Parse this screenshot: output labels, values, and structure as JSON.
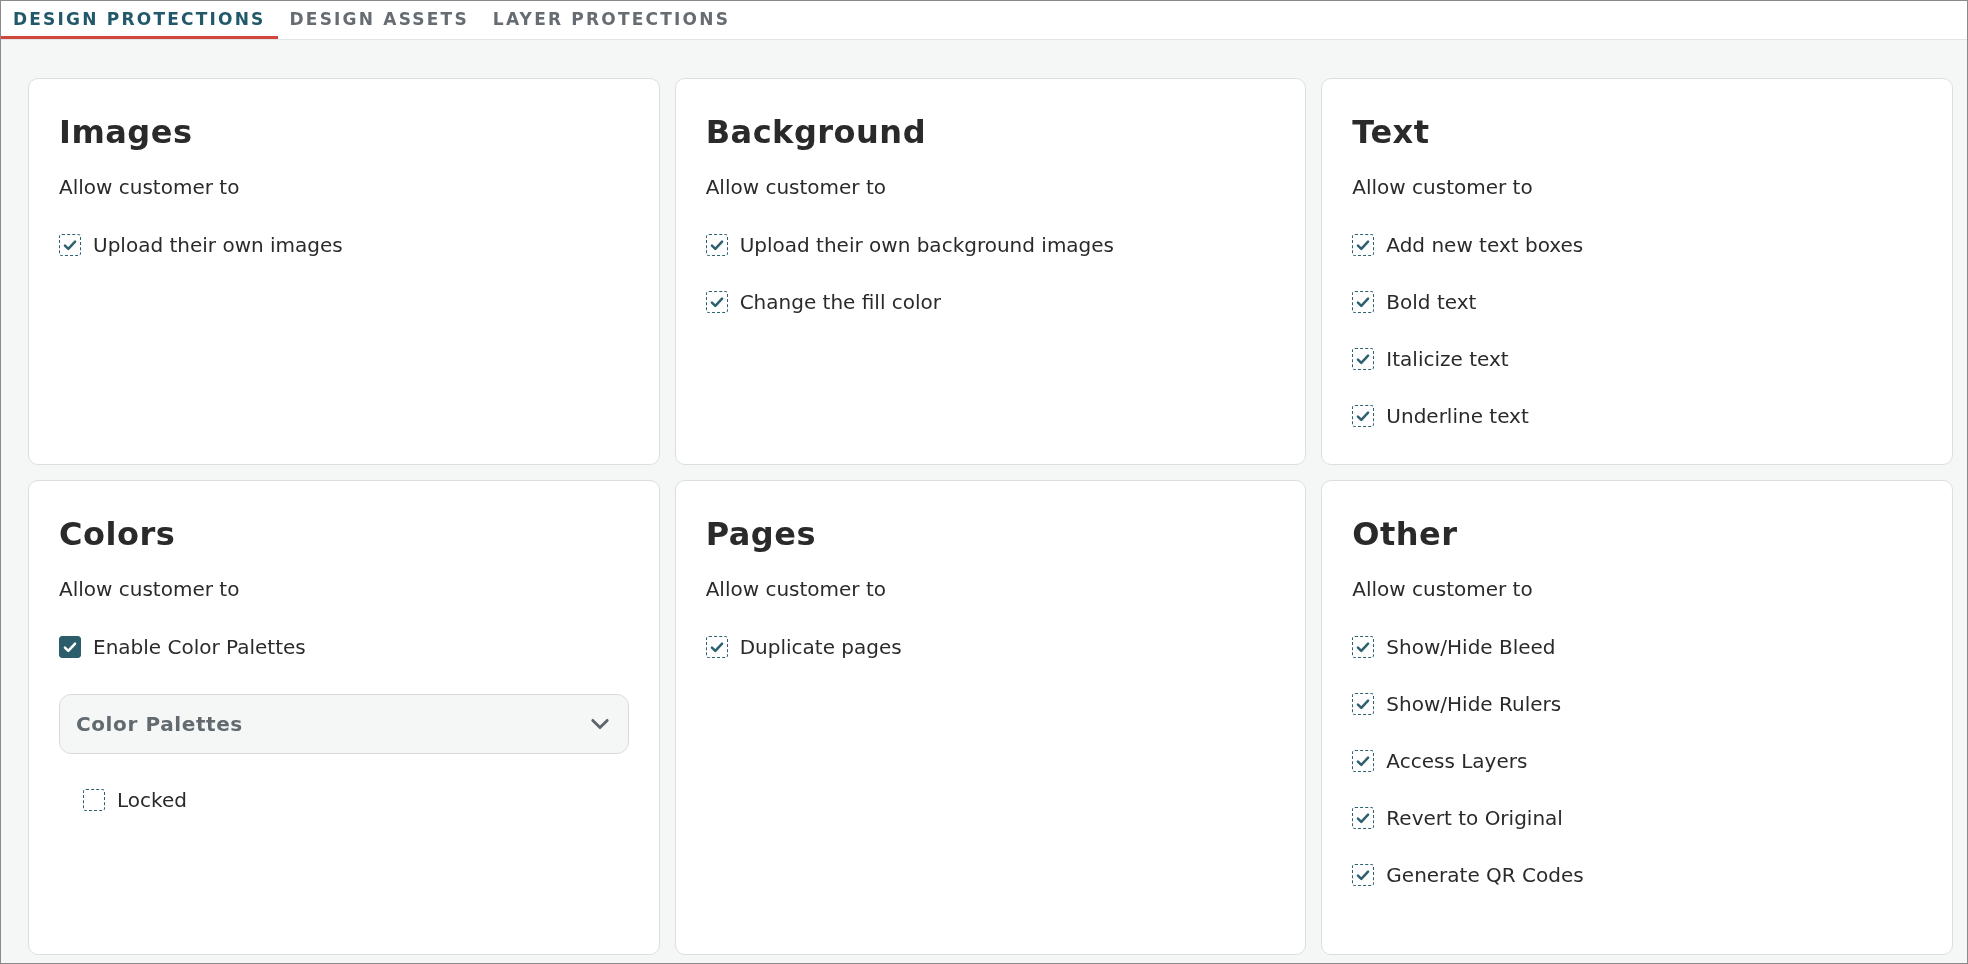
{
  "tabs": [
    {
      "label": "DESIGN PROTECTIONS",
      "selected": true
    },
    {
      "label": "DESIGN ASSETS",
      "selected": false
    },
    {
      "label": "LAYER PROTECTIONS",
      "selected": false
    }
  ],
  "cards": [
    {
      "title": "Images",
      "subtitle": "Allow customer to",
      "items": [
        {
          "kind": "checkbox",
          "label": "Upload their own images",
          "checked": true
        }
      ]
    },
    {
      "title": "Background",
      "subtitle": "Allow customer to",
      "items": [
        {
          "kind": "checkbox",
          "label": "Upload their own background images",
          "checked": true
        },
        {
          "kind": "checkbox",
          "label": "Change the fill color",
          "checked": true
        }
      ]
    },
    {
      "title": "Text",
      "subtitle": "Allow customer to",
      "items": [
        {
          "kind": "checkbox",
          "label": "Add new text boxes",
          "checked": true
        },
        {
          "kind": "checkbox",
          "label": "Bold text",
          "checked": true
        },
        {
          "kind": "checkbox",
          "label": "Italicize text",
          "checked": true
        },
        {
          "kind": "checkbox",
          "label": "Underline text",
          "checked": true
        }
      ]
    },
    {
      "title": "Colors",
      "subtitle": "Allow customer to",
      "items": [
        {
          "kind": "solid-checkbox",
          "label": "Enable Color Palettes",
          "checked": true
        },
        {
          "kind": "dropdown",
          "label": "Color Palettes",
          "children": [
            {
              "kind": "checkbox",
              "label": "Locked",
              "checked": false
            }
          ]
        }
      ]
    },
    {
      "title": "Pages",
      "subtitle": "Allow customer to",
      "items": [
        {
          "kind": "checkbox",
          "label": "Duplicate pages",
          "checked": true
        }
      ]
    },
    {
      "title": "Other",
      "subtitle": "Allow customer to",
      "items": [
        {
          "kind": "checkbox",
          "label": "Show/Hide Bleed",
          "checked": true
        },
        {
          "kind": "checkbox",
          "label": "Show/Hide Rulers",
          "checked": true
        },
        {
          "kind": "checkbox",
          "label": "Access Layers",
          "checked": true
        },
        {
          "kind": "checkbox",
          "label": "Revert to Original",
          "checked": true
        },
        {
          "kind": "checkbox",
          "label": "Generate QR Codes",
          "checked": true
        }
      ]
    }
  ]
}
